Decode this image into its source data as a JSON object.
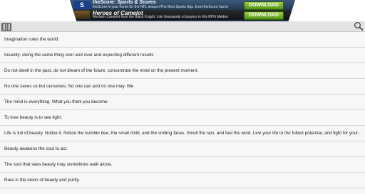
{
  "ad": {
    "row1_title": "theScore: Sports & Scores",
    "row1_desc": "theScore is your home for the NFL season!The Best Sports App. Ever!theScore has been completely",
    "row1_button": "DOWNLOAD",
    "row2_title": "Heroes of Camelot",
    "row2_desc": "Reclaim Camelot from the Black Knight. Join thousands of players in this RPG Medieval Battle Card Game",
    "row2_button": "DOWNLOAD"
  },
  "toolbar": {
    "left_icon": "book-icon",
    "right_icon": "search-icon"
  },
  "quotes": [
    "Imagination rules the world.",
    "Insanity: doing the same thing over and over and expecting different results",
    "Do not dwell in the past, do not dream of the future, concentrate the mind on the present moment.",
    "No one saves us but ourselves. No one can and no one may. We",
    "The mind is everything. What you think you become.",
    "To love beauty is to see light.",
    "Life is full of beauty. Notice it. Notice the bumble bee, the small child, and the smiling faces. Smell the rain, and feel the wind. Live your life to the fullest potential, and fight for your...",
    "Beauty awakens the soul to act.",
    "The soul that sees beauty may sometimes walk alone.",
    "Rare is the union of beauty and purity."
  ]
}
